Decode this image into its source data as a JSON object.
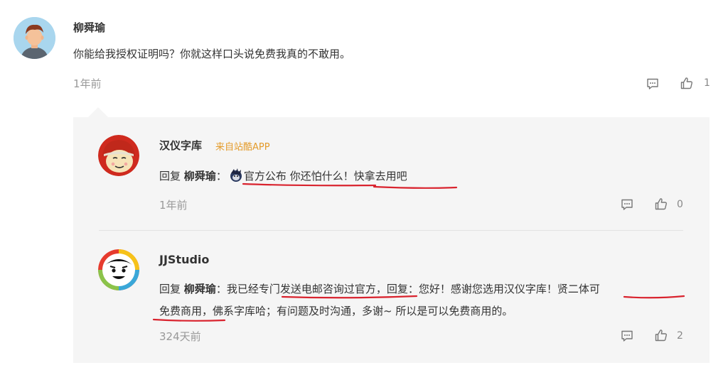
{
  "comment": {
    "author": "柳舜瑜",
    "text": "你能给我授权证明吗？你就这样口头说免费我真的不敢用。",
    "time": "1年前",
    "like_count": "1",
    "reply_icon": "comment-icon",
    "like_icon": "thumbs-up-icon"
  },
  "replies": [
    {
      "author": "汉仪字库",
      "source": "来自站酷APP",
      "reply_prefix": "回复",
      "reply_to": "柳舜瑜",
      "colon": "：",
      "emoji": "doge-emoji",
      "text": "官方公布 你还怕什么！快拿去用吧",
      "time": "1年前",
      "like_count": "0"
    },
    {
      "author": "JJStudio",
      "reply_prefix": "回复",
      "reply_to": "柳舜瑜",
      "colon": "：",
      "text_line1": "我已经专门发送电邮咨询过官方，回复：您好！感谢您选用汉仪字库！贤二体可",
      "text_line2": "免费商用，佛系字库哈；有问题及时沟通，多谢~ 所以是可以免费商用的。",
      "time": "324天前",
      "like_count": "2"
    }
  ],
  "colors": {
    "panel_bg": "#f5f5f5",
    "source_tag": "#e49b2a",
    "annotation_underline": "#d9232e",
    "muted_text": "#999999"
  }
}
